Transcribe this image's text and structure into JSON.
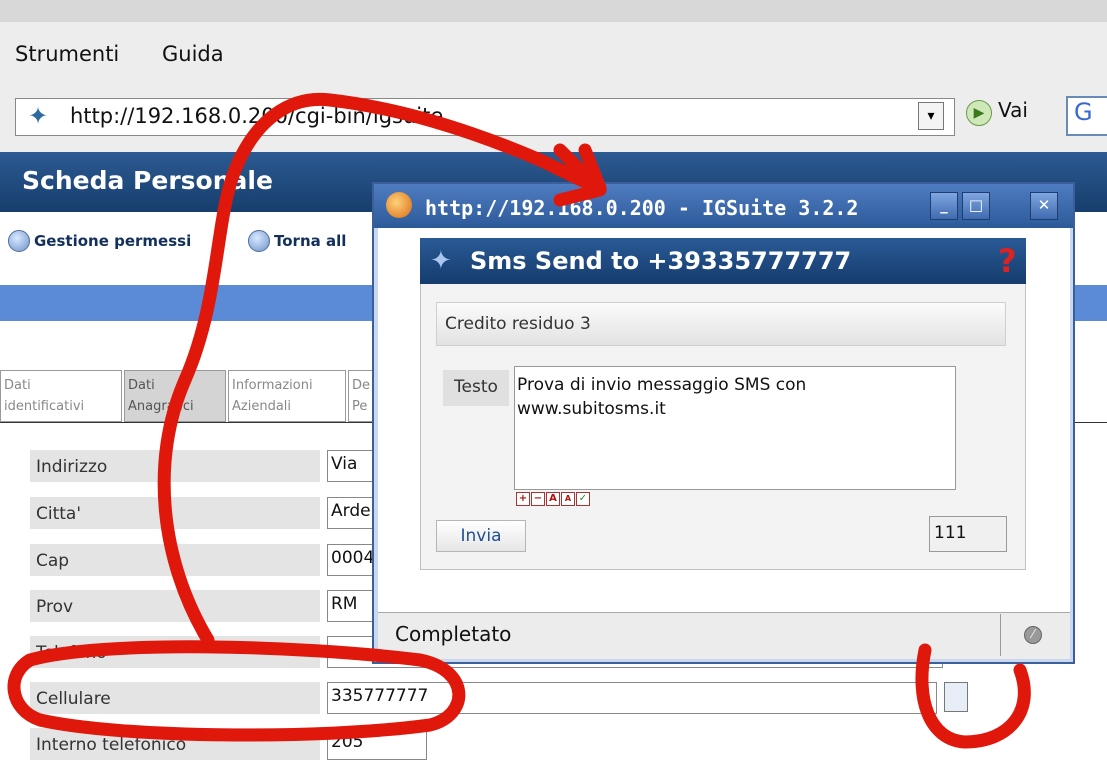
{
  "menu": [
    "Strumenti",
    "Guida"
  ],
  "nav": {
    "url": "http://192.168.0.200/cgi-bin/igsuite",
    "go_label": "Vai",
    "search_logo": "G"
  },
  "page": {
    "title": "Scheda Personale",
    "links": [
      "Gestione permessi",
      "Torna all"
    ],
    "tabs": [
      {
        "line1": "Dati",
        "line2": "identificativi"
      },
      {
        "line1": "Dati",
        "line2": "Anagrafici"
      },
      {
        "line1": "Informazioni",
        "line2": "Aziendali"
      },
      {
        "line1": "De",
        "line2": "Pe"
      }
    ],
    "fields": [
      {
        "label": "Indirizzo",
        "value": "Via"
      },
      {
        "label": "Citta'",
        "value": "Arde"
      },
      {
        "label": "Cap",
        "value": "0004"
      },
      {
        "label": "Prov",
        "value": "RM"
      },
      {
        "label": "Telefono",
        "value": ""
      },
      {
        "label": "Cellulare",
        "value": "335777777"
      },
      {
        "label": "Interno telefonico",
        "value": "205"
      }
    ]
  },
  "popup": {
    "window_title": "http://192.168.0.200 - IGSuite 3.2.2",
    "sms_title": "Sms Send to +39335777777",
    "credito": "Credito residuo 3",
    "testo_label": "Testo",
    "message": "Prova di invio messaggio SMS con www.subitosms.it",
    "format_buttons": [
      "+",
      "−",
      "A",
      "A",
      "✓"
    ],
    "send_label": "Invia",
    "counter": "111",
    "status": "Completato"
  },
  "colors": {
    "header_blue": "#1f4a7e",
    "tab_blue": "#5b8ad6",
    "annotation_red": "#e0180c"
  }
}
